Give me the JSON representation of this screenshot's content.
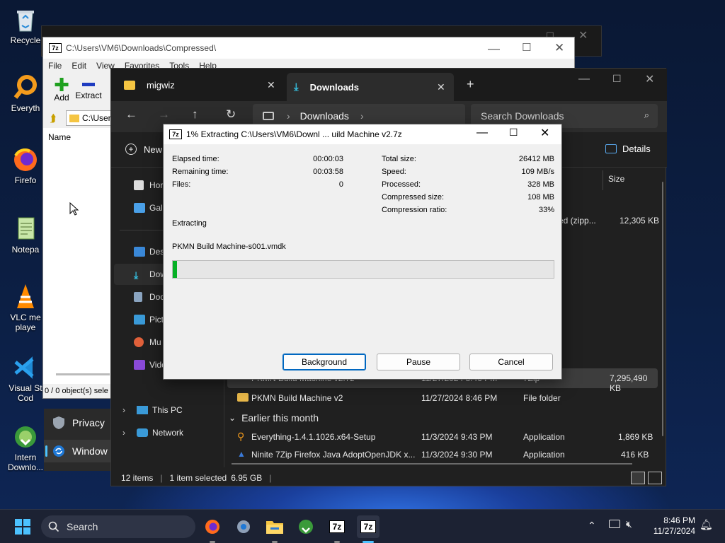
{
  "desktop": {
    "icons": [
      {
        "label": "Recycle",
        "icon": "recycle-bin-icon"
      },
      {
        "label": "Everyth",
        "icon": "everything-search-icon"
      },
      {
        "label": "Firefo",
        "icon": "firefox-icon"
      },
      {
        "label": "Notepa",
        "icon": "notepad-icon"
      },
      {
        "label": "VLC me",
        "label2": "playe",
        "icon": "vlc-icon"
      },
      {
        "label": "Visual St",
        "label2": "Cod",
        "icon": "vscode-icon"
      },
      {
        "label": "Intern",
        "label2": "Downlo...",
        "icon": "internet-download-icon"
      }
    ]
  },
  "sevenzip_fm": {
    "title": "C:\\Users\\VM6\\Downloads\\Compressed\\",
    "menu": [
      "File",
      "Edit",
      "View",
      "Favorites",
      "Tools",
      "Help"
    ],
    "toolbar": {
      "add": "Add",
      "extract": "Extract"
    },
    "address": "C:\\User",
    "column_name": "Name",
    "status": "0 / 0 object(s) sele",
    "start_menu_items": [
      "Privacy",
      "Window"
    ]
  },
  "explorer": {
    "tabs": [
      {
        "label": "migwiz",
        "icon": "folder-icon"
      },
      {
        "label": "Downloads",
        "icon": "download-icon"
      }
    ],
    "breadcrumb": "Downloads",
    "search_placeholder": "Search Downloads",
    "new_label": "New",
    "details_label": "Details",
    "column_size": "Size",
    "nav": [
      "Hor",
      "Gall",
      "Des",
      "Dow",
      "Doc",
      "Pict",
      "Mu",
      "Vide"
    ],
    "nav_bottom": [
      "This PC",
      "Network"
    ],
    "partial_row": {
      "type": "ed (zipp...",
      "size": "12,305 KB"
    },
    "hidden_row": {
      "name": "PKMN Build Machine v2.7z",
      "date": "11/27/2024 8:46 PM",
      "type": "7Zip",
      "size": "7,295,490 KB"
    },
    "files": [
      {
        "name": "PKMN Build Machine v2",
        "date": "11/27/2024 8:46 PM",
        "type": "File folder",
        "size": ""
      }
    ],
    "group": "Earlier this month",
    "files2": [
      {
        "name": "Everything-1.4.1.1026.x64-Setup",
        "date": "11/3/2024 9:43 PM",
        "type": "Application",
        "size": "1,869 KB"
      },
      {
        "name": "Ninite 7Zip Firefox Java AdoptOpenJDK x...",
        "date": "11/3/2024 9:30 PM",
        "type": "Application",
        "size": "416 KB"
      }
    ],
    "status": {
      "items": "12 items",
      "selected": "1 item selected",
      "size": "6.95 GB"
    }
  },
  "dialog": {
    "title": "1% Extracting C:\\Users\\VM6\\Downl ... uild Machine v2.7z",
    "left": [
      {
        "label": "Elapsed time:",
        "value": "00:00:03"
      },
      {
        "label": "Remaining time:",
        "value": "00:03:58"
      },
      {
        "label": "Files:",
        "value": "0"
      }
    ],
    "right": [
      {
        "label": "Total size:",
        "value": "26412 MB"
      },
      {
        "label": "Speed:",
        "value": "109 MB/s"
      },
      {
        "label": "Processed:",
        "value": "328 MB"
      },
      {
        "label": "Compressed size:",
        "value": "108 MB"
      },
      {
        "label": "Compression ratio:",
        "value": "33%"
      }
    ],
    "operation": "Extracting",
    "current_file": "PKMN Build Machine-s001.vmdk",
    "progress_fraction": 0.012,
    "buttons": {
      "background": "Background",
      "pause": "Pause",
      "cancel": "Cancel"
    },
    "accent": "#06b025"
  },
  "taskbar": {
    "search": "Search",
    "time": "8:46 PM",
    "date": "11/27/2024"
  }
}
